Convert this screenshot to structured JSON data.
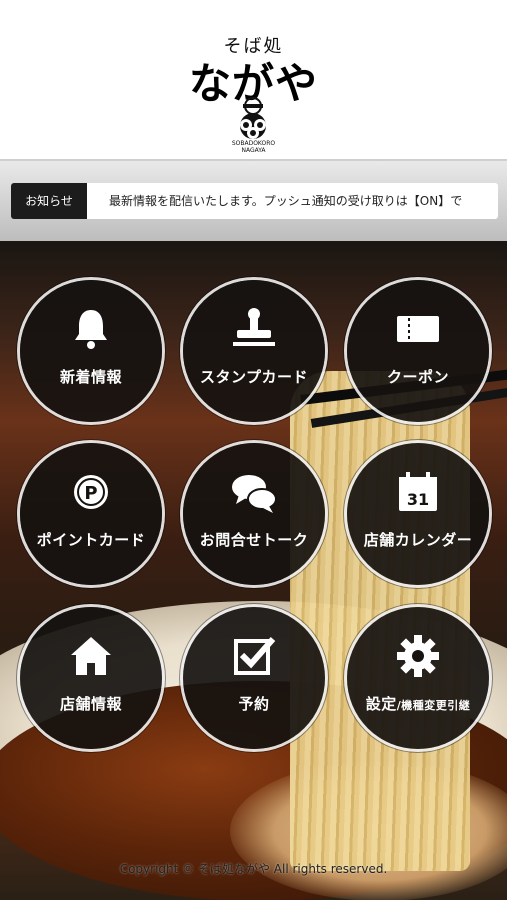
{
  "header": {
    "logo_sub": "そば処",
    "logo_main": "ながや",
    "logo_en_line1": "SOBADOKORO",
    "logo_en_line2": "NAGAYA"
  },
  "news": {
    "label": "お知らせ",
    "text": "最新情報を配信いたします。プッシュ通知の受け取りは【ON】で"
  },
  "menu": [
    {
      "label": "新着情報",
      "icon": "bell-icon"
    },
    {
      "label": "スタンプカード",
      "icon": "stamp-icon"
    },
    {
      "label": "クーポン",
      "icon": "ticket-icon"
    },
    {
      "label": "ポイントカード",
      "icon": "point-coin-icon"
    },
    {
      "label": "お問合せトーク",
      "icon": "chat-bubbles-icon"
    },
    {
      "label": "店舗カレンダー",
      "icon": "calendar-icon",
      "calendar_day": "31"
    },
    {
      "label": "店舗情報",
      "icon": "house-icon"
    },
    {
      "label": "予約",
      "icon": "checkbox-icon"
    },
    {
      "label": "設定",
      "label_sub": "/機種変更引継",
      "icon": "gear-icon"
    }
  ],
  "footer": {
    "copyright": "Copyright © そば処ながや All rights reserved."
  },
  "colors": {
    "button_bg": "#161210",
    "button_ring": "#ffffff",
    "news_label_bg": "#1c1c1c"
  }
}
